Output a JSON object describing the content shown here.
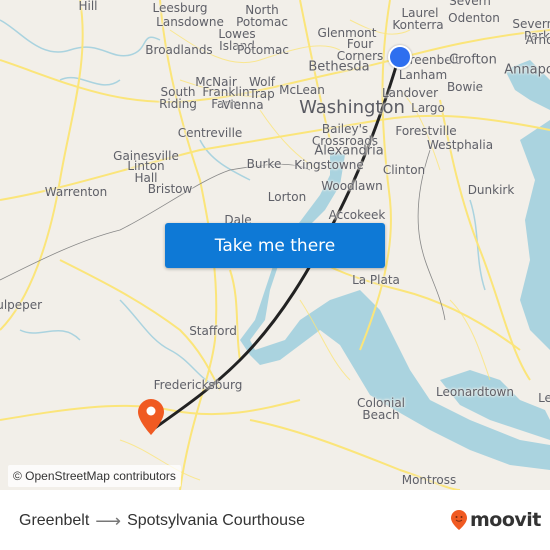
{
  "map": {
    "origin": {
      "name": "Greenbelt",
      "marker": "origin-dot",
      "color": "#2e6fef"
    },
    "destination": {
      "name": "Spotsylvania Courthouse",
      "marker": "map-pin-icon",
      "color": "#f05a22"
    },
    "route_line_color": "#222222",
    "water_color": "#aad3df",
    "road_color": "#fbe57a",
    "land_color": "#f2efe9",
    "places": [
      {
        "name": "Hill"
      },
      {
        "name": "Leesburg"
      },
      {
        "name": "Lansdowne"
      },
      {
        "name": "North\nPotomac"
      },
      {
        "name": "Broadlands"
      },
      {
        "name": "Lowes\nIsland"
      },
      {
        "name": "Potomac"
      },
      {
        "name": "Glenmont"
      },
      {
        "name": "Four\nCorners"
      },
      {
        "name": "Laurel"
      },
      {
        "name": "Konterra"
      },
      {
        "name": "Odenton"
      },
      {
        "name": "Severn"
      },
      {
        "name": "Severna\nPark"
      },
      {
        "name": "Arnold"
      },
      {
        "name": "Greenbelt"
      },
      {
        "name": "Crofton"
      },
      {
        "name": "Annapolis"
      },
      {
        "name": "Bethesda"
      },
      {
        "name": "Lanham"
      },
      {
        "name": "McNair"
      },
      {
        "name": "Wolf\nTrap"
      },
      {
        "name": "South\nRiding"
      },
      {
        "name": "Franklin\nFarm"
      },
      {
        "name": "Vienna"
      },
      {
        "name": "McLean"
      },
      {
        "name": "Landover"
      },
      {
        "name": "Bowie"
      },
      {
        "name": "Washington"
      },
      {
        "name": "Largo"
      },
      {
        "name": "Centreville"
      },
      {
        "name": "Bailey's\nCrossroads"
      },
      {
        "name": "Forestville"
      },
      {
        "name": "Westphalia"
      },
      {
        "name": "Gainesville"
      },
      {
        "name": "Alexandria"
      },
      {
        "name": "Linton\nHall"
      },
      {
        "name": "Burke"
      },
      {
        "name": "Kingstowne"
      },
      {
        "name": "Clinton"
      },
      {
        "name": "Warrenton"
      },
      {
        "name": "Bristow"
      },
      {
        "name": "Woodlawn"
      },
      {
        "name": "Lorton"
      },
      {
        "name": "Dunkirk"
      },
      {
        "name": "Accokeek"
      },
      {
        "name": "Dale"
      },
      {
        "name": "La Plata"
      },
      {
        "name": "Culpeper"
      },
      {
        "name": "Stafford"
      },
      {
        "name": "Fredericksburg"
      },
      {
        "name": "Leonardtown"
      },
      {
        "name": "Le"
      },
      {
        "name": "Colonial\nBeach"
      },
      {
        "name": "Montross"
      }
    ],
    "attribution": "© OpenStreetMap contributors",
    "cta_label": "Take me there"
  },
  "footer": {
    "from": "Greenbelt",
    "arrow": "⟶",
    "to": "Spotsylvania Courthouse",
    "brand": "moovit",
    "brand_color": "#f05a22"
  }
}
